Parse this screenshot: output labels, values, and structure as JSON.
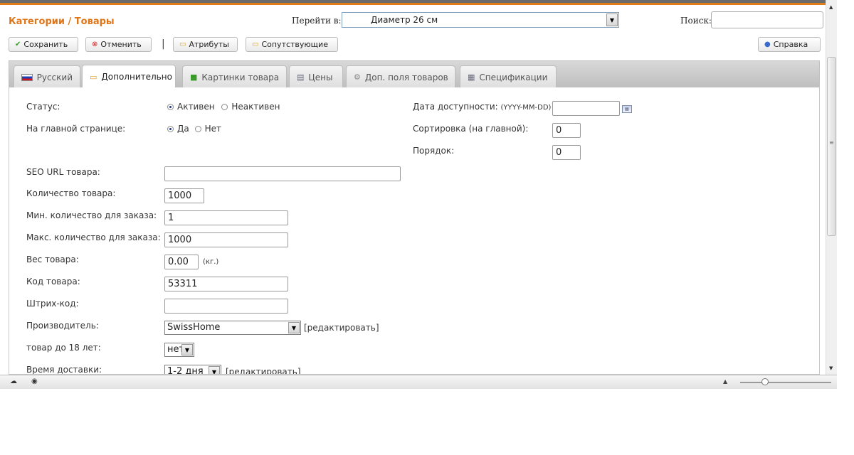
{
  "header": {
    "breadcrumb": "Категории / Товары",
    "goto_label": "Перейти в:",
    "goto_value": "Диаметр 26 см",
    "search_label": "Поиск:",
    "search_value": ""
  },
  "toolbar": {
    "save": "Сохранить",
    "cancel": "Отменить",
    "separator": "|",
    "attributes": "Атрибуты",
    "related": "Сопутствующие",
    "help": "Справка"
  },
  "tabs": [
    {
      "label": "Русский",
      "icon": "flag-ru-icon"
    },
    {
      "label": "Дополнительно",
      "icon": "note-icon",
      "active": true
    },
    {
      "label": "Картинки товара",
      "icon": "image-icon"
    },
    {
      "label": "Цены",
      "icon": "price-icon"
    },
    {
      "label": "Доп. поля товаров",
      "icon": "gear-icon"
    },
    {
      "label": "Спецификации",
      "icon": "spec-icon"
    }
  ],
  "form": {
    "status": {
      "label": "Статус:",
      "opt_active": "Активен",
      "opt_inactive": "Неактивен",
      "selected": "Активен"
    },
    "home": {
      "label": "На главной странице:",
      "opt_yes": "Да",
      "opt_no": "Нет",
      "selected": "Да"
    },
    "availability": {
      "label": "Дата доступности:",
      "format": "(YYYY-MM-DD)",
      "value": ""
    },
    "sort_home": {
      "label": "Сортировка (на главной):",
      "value": "0"
    },
    "order": {
      "label": "Порядок:",
      "value": "0"
    },
    "seo_url": {
      "label": "SEO URL товара:",
      "value": ""
    },
    "quantity": {
      "label": "Количество товара:",
      "value": "1000"
    },
    "min_qty": {
      "label": "Мин. количество для заказа:",
      "value": "1"
    },
    "max_qty": {
      "label": "Макс. количество для заказа:",
      "value": "1000"
    },
    "weight": {
      "label": "Вес товара:",
      "value": "0.00",
      "unit": "(кг.)"
    },
    "code": {
      "label": "Код товара:",
      "value": "53311"
    },
    "barcode": {
      "label": "Штрих-код:",
      "value": ""
    },
    "manufacturer": {
      "label": "Производитель:",
      "value": "SwissHome",
      "edit": "[редактировать]"
    },
    "under18": {
      "label": "товар до 18 лет:",
      "value": "нет"
    },
    "delivery": {
      "label": "Время доставки:",
      "value": "1-2 дня",
      "edit": "[редактировать]"
    }
  },
  "colors": {
    "accent": "#e0761a",
    "tabbar": "#c8c8c8"
  }
}
